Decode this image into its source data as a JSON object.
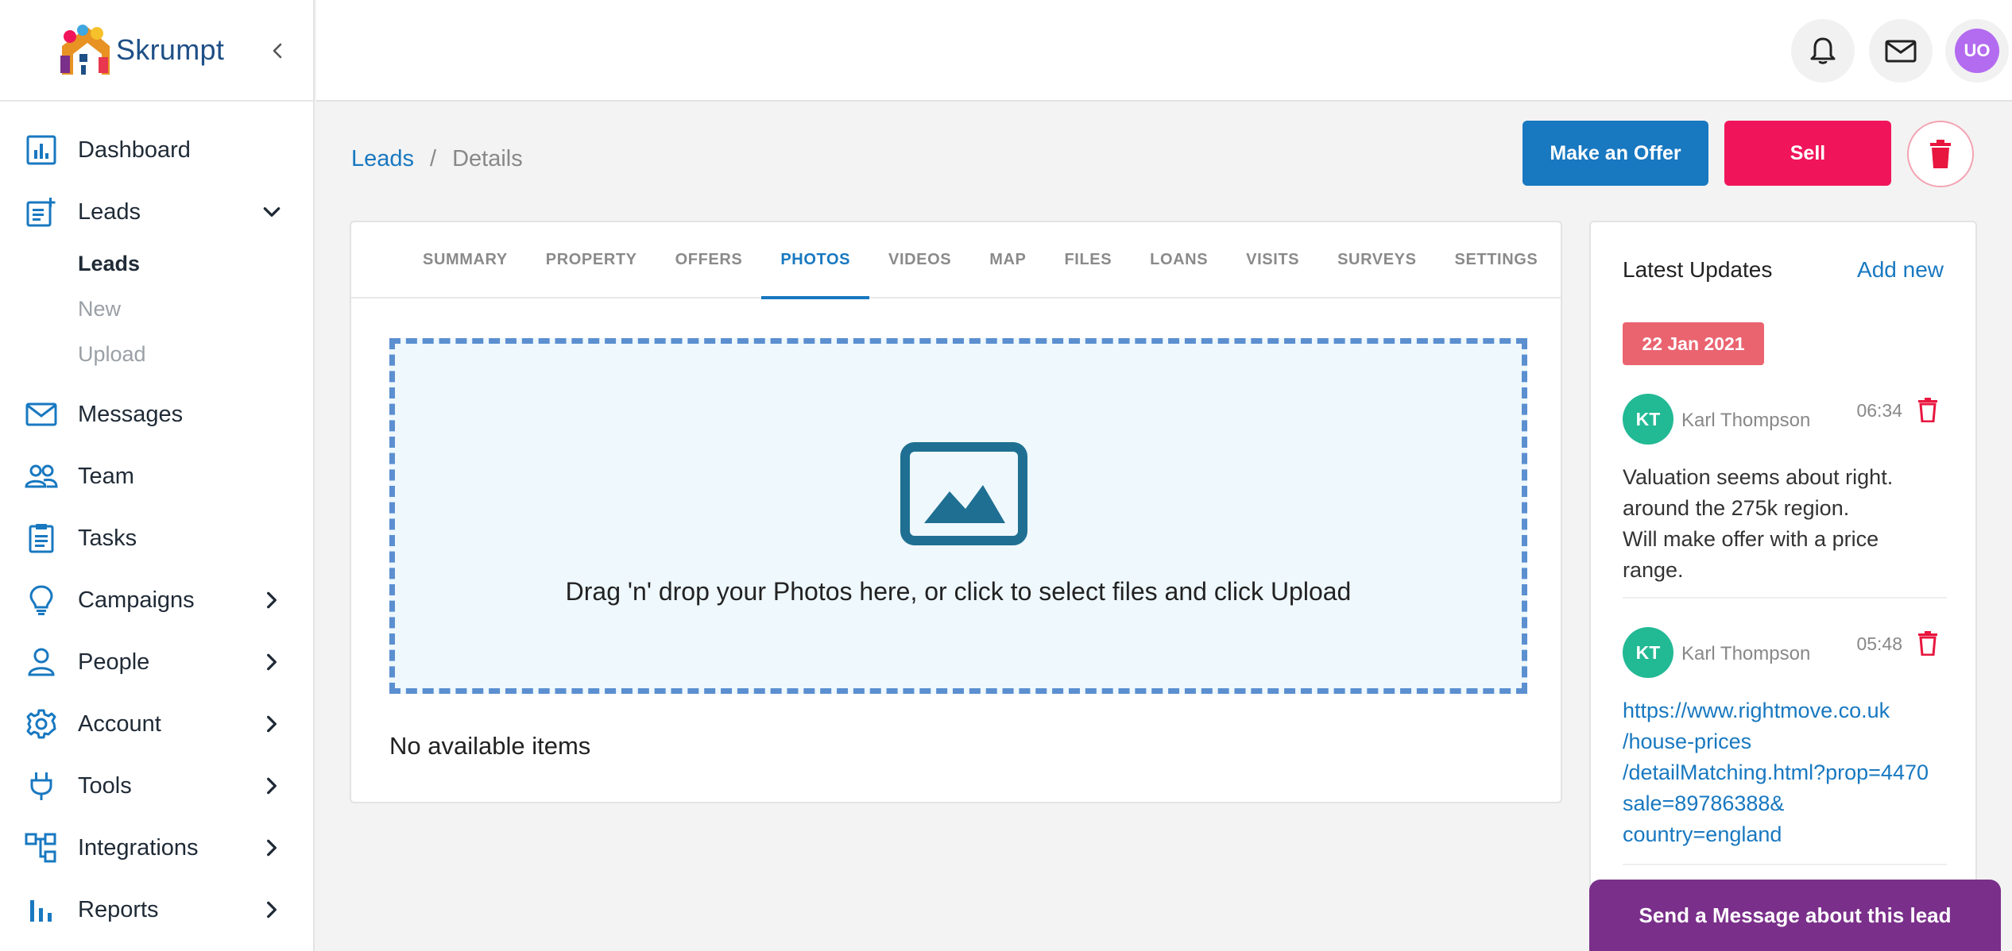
{
  "brand": {
    "name": "Skrumpt"
  },
  "sidebar": {
    "items": [
      {
        "label": "Dashboard",
        "icon": "dashboard-icon"
      },
      {
        "label": "Leads",
        "icon": "leads-icon",
        "expanded": true,
        "children": [
          {
            "label": "Leads",
            "active": true
          },
          {
            "label": "New"
          },
          {
            "label": "Upload"
          }
        ]
      },
      {
        "label": "Messages",
        "icon": "mail-icon"
      },
      {
        "label": "Team",
        "icon": "team-icon"
      },
      {
        "label": "Tasks",
        "icon": "tasks-icon"
      },
      {
        "label": "Campaigns",
        "icon": "lightbulb-icon"
      },
      {
        "label": "People",
        "icon": "person-icon"
      },
      {
        "label": "Account",
        "icon": "gear-icon"
      },
      {
        "label": "Tools",
        "icon": "plug-icon"
      },
      {
        "label": "Integrations",
        "icon": "integrations-icon"
      },
      {
        "label": "Reports",
        "icon": "bar-chart-icon"
      }
    ]
  },
  "topbar": {
    "avatar_initials": "UO"
  },
  "breadcrumb": {
    "parent": "Leads",
    "separator": "/",
    "current": "Details"
  },
  "actions": {
    "offer_label": "Make an Offer",
    "sell_label": "Sell"
  },
  "tabs": [
    {
      "label": "SUMMARY"
    },
    {
      "label": "PROPERTY"
    },
    {
      "label": "OFFERS"
    },
    {
      "label": "PHOTOS",
      "active": true
    },
    {
      "label": "VIDEOS"
    },
    {
      "label": "MAP"
    },
    {
      "label": "FILES"
    },
    {
      "label": "LOANS"
    },
    {
      "label": "VISITS"
    },
    {
      "label": "SURVEYS"
    },
    {
      "label": "SETTINGS"
    }
  ],
  "photos": {
    "dropzone_text": "Drag 'n' drop your Photos here, or click to select files and click Upload",
    "empty_text": "No available items"
  },
  "updates": {
    "title": "Latest Updates",
    "add_label": "Add new",
    "date": "22 Jan 2021",
    "entries": [
      {
        "initials": "KT",
        "author": "Karl Thompson",
        "time": "06:34",
        "lines": [
          "Valuation seems about right.",
          "around the 275k region.",
          "Will make offer with a price",
          "range."
        ]
      },
      {
        "initials": "KT",
        "author": "Karl Thompson",
        "time": "05:48",
        "link_lines": [
          "https://www.rightmove.co.uk",
          "/house-prices",
          "/detailMatching.html?prop=4470",
          "sale=89786388&",
          "country=england"
        ]
      }
    ]
  },
  "send_message_label": "Send a Message about this lead",
  "colors": {
    "primary": "#1878c0",
    "sell": "#f0155a",
    "date_badge": "#ea6470",
    "avatar": "#22b995",
    "send": "#7a2f8a"
  }
}
